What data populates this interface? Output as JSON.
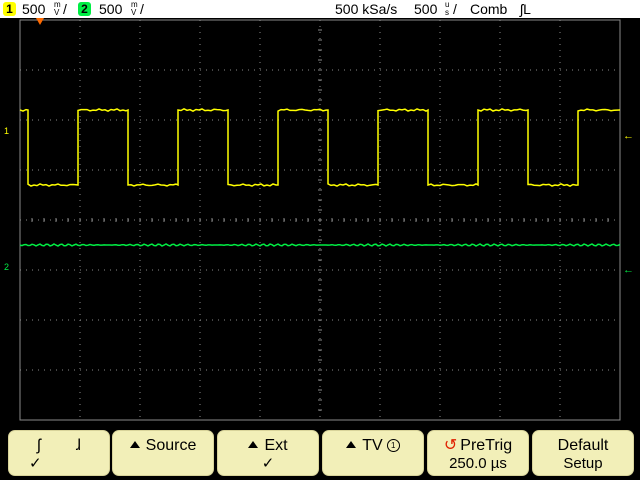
{
  "status": {
    "ch1": {
      "number": "1",
      "scale": "500",
      "unit_top": "m",
      "unit_bottom": "V",
      "color": "#ffff00"
    },
    "ch2": {
      "number": "2",
      "scale": "500",
      "unit_top": "m",
      "unit_bottom": "V",
      "color": "#00ee44"
    },
    "sample_rate": "500 kSa/s",
    "timebase": {
      "value": "500",
      "unit_top": "u",
      "unit_bottom": "s"
    },
    "acq_mode": "Comb",
    "trigger": "ʃL"
  },
  "screen": {
    "background": "#000000",
    "grid_color": "#8a8a8a",
    "trigger_marker_color": "#ff6a00",
    "ch1": {
      "marker_label": "1",
      "color": "#ffff00",
      "waveform": "square",
      "high_div": -2.2,
      "low_div": -0.7,
      "transitions_x": [
        28,
        78,
        128,
        178,
        228,
        278,
        328,
        378,
        428,
        478,
        528,
        578
      ]
    },
    "ch2": {
      "marker_label": "2",
      "color": "#00ee44",
      "waveform": "flat",
      "level_div": 0.5
    }
  },
  "softkeys": [
    {
      "id": "slope",
      "line1_a": "ʃ",
      "line1_b": "ɺ",
      "line2": "✓"
    },
    {
      "id": "source",
      "line1": "Source",
      "line2": ""
    },
    {
      "id": "ext",
      "line1": "Ext",
      "line2": "✓"
    },
    {
      "id": "tv",
      "line1": "TV",
      "badge": "1",
      "line2": ""
    },
    {
      "id": "pretrig",
      "icon": "↺",
      "line1": "PreTrig",
      "line2": "250.0 µs"
    },
    {
      "id": "default",
      "line1": "Default",
      "line2": "Setup"
    }
  ]
}
